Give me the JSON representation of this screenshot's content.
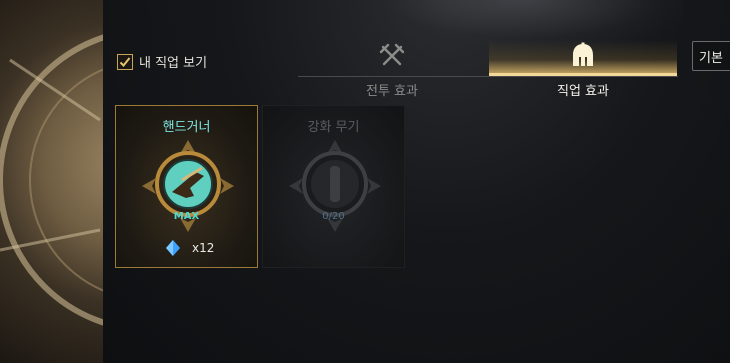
{
  "header": {
    "my_job_checkbox": {
      "label": "내 직업 보기",
      "checked": true
    },
    "basic_button_label": "기본"
  },
  "tabs": [
    {
      "label": "전투 효과",
      "icon": "crossed-swords-icon",
      "active": false
    },
    {
      "label": "직업 효과",
      "icon": "spartan-helmet-icon",
      "active": true
    }
  ],
  "cards": [
    {
      "title": "핸드거너",
      "level": "MAX",
      "cost_value": "x12",
      "icon": "handgun-icon",
      "state": "unlocked"
    },
    {
      "title": "강화 무기",
      "level": "0/20",
      "icon": "weapon-emblem-icon",
      "state": "locked"
    }
  ],
  "colors": {
    "accent_gold": "#d7b46a",
    "cyan": "#7fe6e2"
  }
}
